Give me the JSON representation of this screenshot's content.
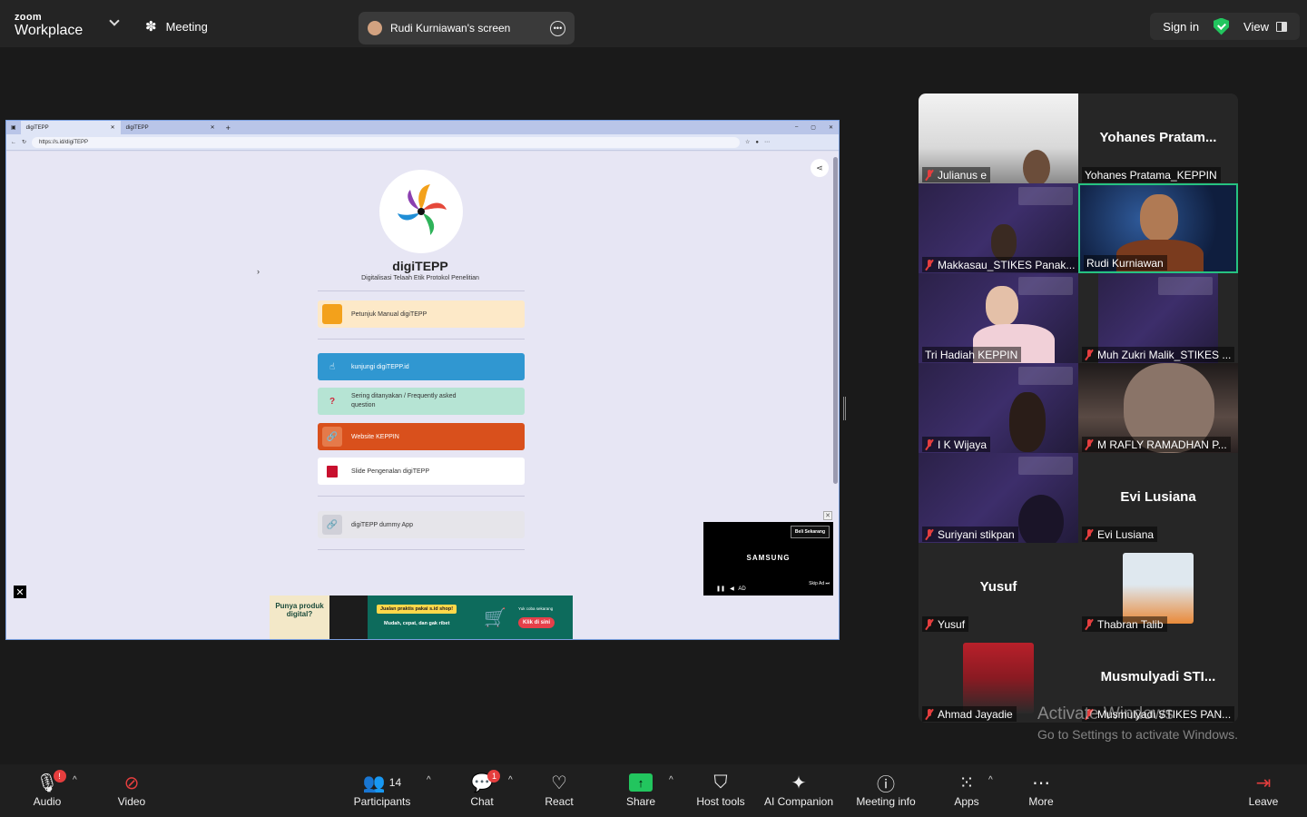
{
  "app": {
    "brand_small": "zoom",
    "brand_large": "Workplace",
    "meeting_label": "Meeting"
  },
  "screen_share": {
    "label": "Rudi Kurniawan's screen"
  },
  "top_right": {
    "signin": "Sign in",
    "view": "View"
  },
  "browser": {
    "tabs": [
      {
        "title": "digiTEPP"
      },
      {
        "title": "digiTEPP"
      }
    ],
    "url": "https://s.id/digiTEPP",
    "page": {
      "title": "digiTEPP",
      "subtitle": "Digitalisasi Telaah Etik Protokol Penelitian",
      "links": [
        {
          "label": "Petunjuk Manual digiTEPP",
          "color": "#fde9c8"
        },
        {
          "label": "kunjungi digiTEPP.id",
          "color": "#3097d1"
        },
        {
          "label": "Sering ditanyakan / Frequently asked question",
          "color": "#b6e4d4"
        },
        {
          "label": "Website KEPPIN",
          "color": "#d9501c"
        },
        {
          "label": "Slide Pengenalan digiTEPP",
          "color": "#ffffff"
        },
        {
          "label": "digiTEPP dummy App",
          "color": "#e6e5ea"
        }
      ],
      "banner": {
        "left_text": "Punya produk digital?",
        "yellow_text": "Jualan praktis pakai s.id shop!",
        "white_text": "Mudah, cepat, dan gak ribet",
        "small_text": "Yuk coba sekarang",
        "cta": "Klik di sini"
      },
      "video_ad": {
        "beli": "Beli Sekarang",
        "brand": "SAMSUNG",
        "skip": "Skip Ad",
        "ad": "AD"
      }
    }
  },
  "participants_tiles": [
    {
      "name": "Julianus e",
      "muted": true,
      "big": ""
    },
    {
      "name": "Yohanes Pratama_KEPPIN",
      "muted": false,
      "big": "Yohanes  Pratam..."
    },
    {
      "name": "Makkasau_STIKES Panak...",
      "muted": true,
      "big": ""
    },
    {
      "name": "Rudi Kurniawan",
      "muted": false,
      "big": "",
      "active": true
    },
    {
      "name": "Tri Hadiah KEPPIN",
      "muted": false,
      "big": ""
    },
    {
      "name": "Muh Zukri Malik_STIKES ...",
      "muted": true,
      "big": ""
    },
    {
      "name": "I K Wijaya",
      "muted": true,
      "big": ""
    },
    {
      "name": "M RAFLY RAMADHAN P...",
      "muted": true,
      "big": ""
    },
    {
      "name": "Suriyani stikpan",
      "muted": true,
      "big": ""
    },
    {
      "name": "Evi Lusiana",
      "muted": true,
      "big": "Evi Lusiana"
    },
    {
      "name": "Yusuf",
      "muted": true,
      "big": "Yusuf"
    },
    {
      "name": "Thabran Talib",
      "muted": true,
      "big": ""
    },
    {
      "name": "Ahmad Jayadie",
      "muted": true,
      "big": ""
    },
    {
      "name": "Musmulyadi STIKES PAN...",
      "muted": true,
      "big": "Musmulyadi  STI..."
    }
  ],
  "watermark": {
    "line1": "Activate Windows",
    "line2": "Go to Settings to activate Windows."
  },
  "toolbar": {
    "audio": "Audio",
    "audio_badge": "!",
    "video": "Video",
    "participants": "Participants",
    "participants_count": "14",
    "chat": "Chat",
    "chat_badge": "1",
    "react": "React",
    "share": "Share",
    "host_tools": "Host tools",
    "ai_companion": "AI Companion",
    "meeting_info": "Meeting info",
    "apps": "Apps",
    "more": "More",
    "leave": "Leave"
  },
  "colors": {
    "accent_green": "#22c55e",
    "mute_red": "#e53e3e",
    "active_border": "#26c281"
  }
}
